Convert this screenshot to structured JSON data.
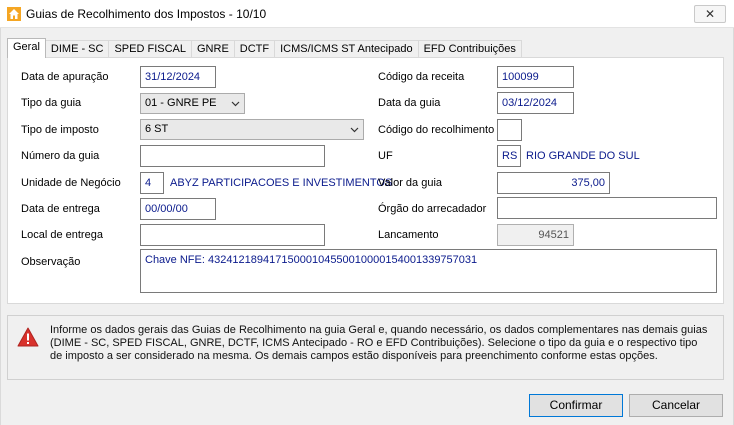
{
  "window": {
    "title": "Guias de Recolhimento dos Impostos - 10/10",
    "close_label": "✕"
  },
  "tabs": [
    {
      "label": "Geral"
    },
    {
      "label": "DIME - SC"
    },
    {
      "label": "SPED FISCAL"
    },
    {
      "label": "GNRE"
    },
    {
      "label": "DCTF"
    },
    {
      "label": "ICMS/ICMS ST Antecipado"
    },
    {
      "label": "EFD Contribuições"
    }
  ],
  "form": {
    "data_apuracao": {
      "label": "Data de apuração",
      "value": "31/12/2024"
    },
    "tipo_guia": {
      "label": "Tipo da guia",
      "value": "01 - GNRE PE"
    },
    "tipo_imposto": {
      "label": "Tipo de imposto",
      "value": "6 ST"
    },
    "numero_guia": {
      "label": "Número da guia",
      "value": ""
    },
    "unidade_negocio": {
      "label": "Unidade de Negócio",
      "code": "4",
      "name": "ABYZ PARTICIPACOES E INVESTIMENTOS"
    },
    "data_entrega": {
      "label": "Data de entrega",
      "value": "00/00/00"
    },
    "local_entrega": {
      "label": "Local de entrega",
      "value": ""
    },
    "observacao": {
      "label": "Observação",
      "value": "Chave NFE: 43241218941715000104550010000154001339757031"
    },
    "codigo_receita": {
      "label": "Código da receita",
      "value": "100099"
    },
    "data_guia": {
      "label": "Data da guia",
      "value": "03/12/2024"
    },
    "codigo_recolhimento": {
      "label": "Código do recolhimento",
      "value": ""
    },
    "uf": {
      "label": "UF",
      "value": "RS",
      "name": "RIO GRANDE DO SUL"
    },
    "valor_guia": {
      "label": "Valor da guia",
      "value": "375,00"
    },
    "orgao_arrecadador": {
      "label": "Órgão do arrecadador",
      "value": ""
    },
    "lancamento": {
      "label": "Lancamento",
      "value": "94521"
    }
  },
  "info": {
    "text": "Informe os dados gerais das Guias de Recolhimento na guia Geral e, quando necessário, os dados complementares nas demais guias (DIME - SC, SPED FISCAL, GNRE, DCTF, ICMS Antecipado - RO e EFD Contribuições). Selecione o tipo da guia e o respectivo tipo de imposto a ser considerado na mesma. Os demais campos estão disponíveis para preenchimento conforme estas opções."
  },
  "buttons": {
    "confirm": "Confirmar",
    "cancel": "Cancelar"
  },
  "colors": {
    "value_text": "#0a1a8c",
    "warning": "#d8322c",
    "accent": "#0078d7"
  }
}
